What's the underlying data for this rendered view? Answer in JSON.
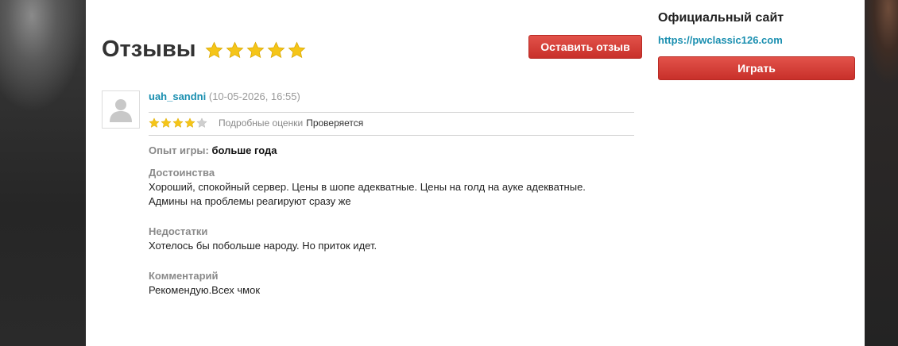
{
  "header": {
    "title": "Отзывы",
    "rating_stars": 5,
    "review_button": "Оставить отзыв"
  },
  "sidebar": {
    "title": "Официальный сайт",
    "link": "https://pwclassic126.com",
    "play_button": "Играть"
  },
  "review": {
    "user": "uah_sandni",
    "date": "(10-05-2026, 16:55)",
    "stars": 4,
    "stars_max": 5,
    "rating_label": "Подробные оценки",
    "rating_status": "Проверяется",
    "experience_label": "Опыт игры:",
    "experience_value": "больше года",
    "pros_label": "Достоинства",
    "pros_text": "Хороший, спокойный сервер. Цены в шопе адекватные. Цены на голд на ауке адекватные. Админы на проблемы реагируют сразу же",
    "cons_label": "Недостатки",
    "cons_text": "Хотелось бы побольше народу. Но приток идет.",
    "comment_label": "Комментарий",
    "comment_text": "Рекомендую.Всех чмок"
  },
  "colors": {
    "star_full": "#f5c518",
    "star_empty": "#cfcfcf",
    "link": "#1a8fb0",
    "button_red": "#d33b33"
  }
}
